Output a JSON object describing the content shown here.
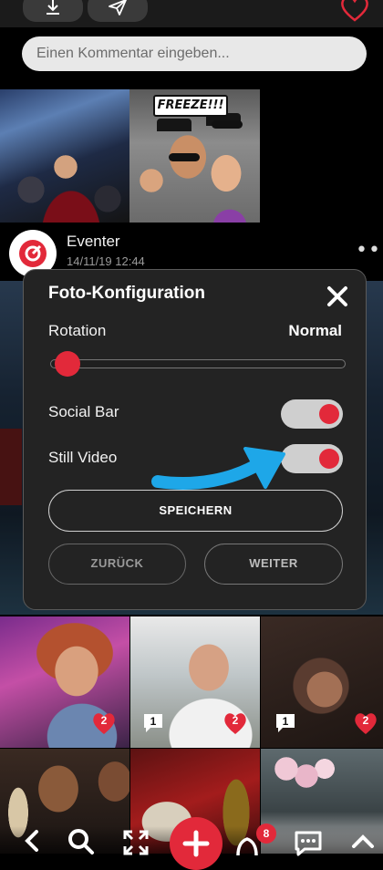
{
  "top_bar": {
    "download_icon": "download-icon",
    "share_icon": "send-icon",
    "like_icon": "heart-outline-icon"
  },
  "comment": {
    "placeholder": "Einen Kommentar eingeben..."
  },
  "gallery_top": {
    "freeze_sign": "FREEZE!!!"
  },
  "post": {
    "author": "Eventer",
    "date": "14/11/19 12:44",
    "more_icon": "more-dots-icon"
  },
  "modal": {
    "title": "Foto-Konfiguration",
    "rotation_label": "Rotation",
    "rotation_value": "Normal",
    "rotation_level": 0.0,
    "social_bar_label": "Social Bar",
    "social_bar_on": true,
    "still_video_label": "Still Video",
    "still_video_on": true,
    "save_label": "SPEICHERN",
    "back_label": "ZURÜCK",
    "next_label": "WEITER"
  },
  "grid": {
    "tile1_likes": "2",
    "tile2_comments": "1",
    "tile2_likes": "2",
    "tile3_comments": "1",
    "tile3_likes": "2"
  },
  "nav": {
    "notifications": "8"
  },
  "colors": {
    "accent": "#e2293a",
    "modal_bg": "#232323",
    "arrow": "#1ea7e8"
  }
}
